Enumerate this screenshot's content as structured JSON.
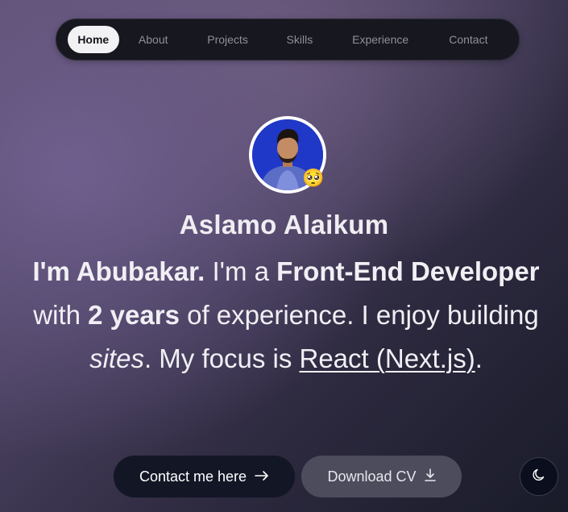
{
  "nav": {
    "items": [
      {
        "label": "Home",
        "active": true
      },
      {
        "label": "About",
        "active": false
      },
      {
        "label": "Projects",
        "active": false
      },
      {
        "label": "Skills",
        "active": false
      },
      {
        "label": "Experience",
        "active": false
      },
      {
        "label": "Contact",
        "active": false
      }
    ]
  },
  "hero": {
    "avatar_icon": "profile-photo",
    "badge_emoji": "🥺",
    "greeting": "Aslamo Alaikum",
    "intro": {
      "im": "I'm Abubakar.",
      "im_a": " I'm a ",
      "role": "Front-End Developer",
      "with": " with ",
      "years": "2 years",
      "of_experience": " of experience. I enjoy building ",
      "sites": "sites",
      "my_focus": ". My focus is ",
      "focus": "React (Next.js)",
      "end": "."
    }
  },
  "buttons": {
    "contact_label": "Contact me here",
    "contact_icon": "arrow-right-icon",
    "download_label": "Download CV",
    "download_icon": "download-icon"
  },
  "theme_toggle": {
    "icon": "moon-icon"
  },
  "colors": {
    "background_top": "#6f5f8e",
    "background_bottom": "#191b29",
    "nav_bg": "#16171f",
    "contact_btn_bg": "#131625",
    "cv_btn_bg": "#4c4c5c"
  }
}
